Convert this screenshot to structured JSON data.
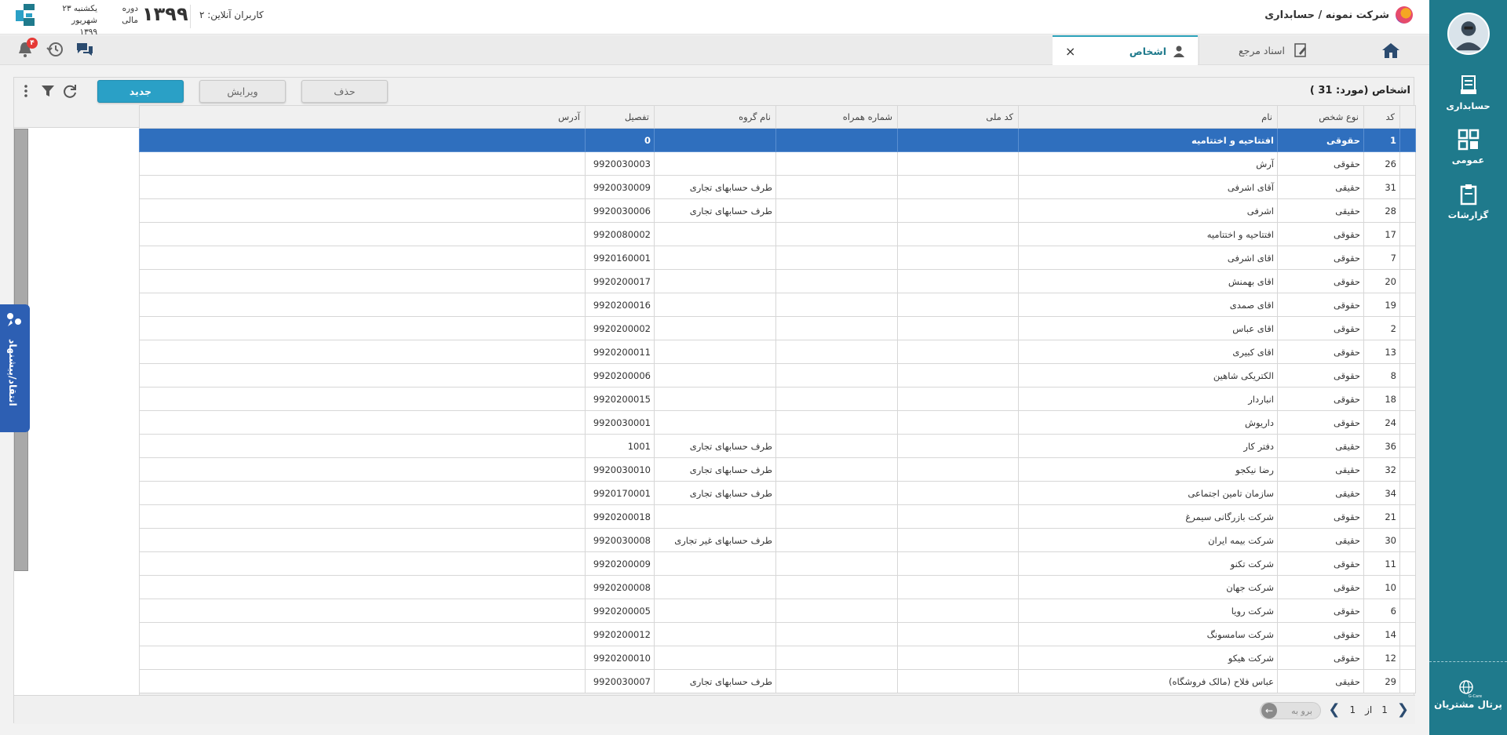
{
  "header": {
    "company": "شرکت نمونه / حسابداری",
    "online_users": "کاربران آنلاین: ۲",
    "fiscal_year": "۱۳۹۹",
    "period_line1": "دوره",
    "period_line2": "مالی",
    "date_line1": "یکشنبه ۲۳",
    "date_line2": "شهریور ۱۳۹۹",
    "notification_count": "۴"
  },
  "sidebar": {
    "items": [
      {
        "label": "حسابداری",
        "icon": "accounting-icon"
      },
      {
        "label": "عمومی",
        "icon": "general-icon"
      },
      {
        "label": "گزارشات",
        "icon": "reports-icon"
      }
    ],
    "portal_label": "پرتال مشتریان",
    "portal_sub": "G-Care"
  },
  "tabs": {
    "reference_docs": "اسناد مرجع",
    "persons": "اشخاص",
    "close_symbol": "×"
  },
  "panel": {
    "title": "اشخاص (مورد:  31 )",
    "btn_new": "جدید",
    "btn_edit": "ویرایش",
    "btn_delete": "حذف"
  },
  "table": {
    "columns": [
      "کد",
      "نوع شخص",
      "نام",
      "کد ملی",
      "شماره همراه",
      "نام گروه",
      "تفصیل",
      "آدرس"
    ],
    "rows": [
      [
        "1",
        "حقوقی",
        "افتتاحیه و اختتامیه",
        "",
        "",
        "",
        "0",
        ""
      ],
      [
        "26",
        "حقوقی",
        "آرش",
        "",
        "",
        "",
        "9920030003",
        ""
      ],
      [
        "31",
        "حقیقی",
        "آقای اشرفی",
        "",
        "",
        "طرف حسابهای تجاری",
        "9920030009",
        ""
      ],
      [
        "28",
        "حقیقی",
        "اشرفی",
        "",
        "",
        "طرف حسابهای تجاری",
        "9920030006",
        ""
      ],
      [
        "17",
        "حقوقی",
        "افتتاحیه و اختتامیه",
        "",
        "",
        "",
        "9920080002",
        ""
      ],
      [
        "7",
        "حقوقی",
        "اقای اشرفی",
        "",
        "",
        "",
        "9920160001",
        ""
      ],
      [
        "20",
        "حقوقی",
        "اقای بهمنش",
        "",
        "",
        "",
        "9920200017",
        ""
      ],
      [
        "19",
        "حقوقی",
        "اقای صمدی",
        "",
        "",
        "",
        "9920200016",
        ""
      ],
      [
        "2",
        "حقوقی",
        "اقای عباس",
        "",
        "",
        "",
        "9920200002",
        ""
      ],
      [
        "13",
        "حقوقی",
        "اقای کبیری",
        "",
        "",
        "",
        "9920200011",
        ""
      ],
      [
        "8",
        "حقوقی",
        "الکتریکی شاهین",
        "",
        "",
        "",
        "9920200006",
        ""
      ],
      [
        "18",
        "حقوقی",
        "انباردار",
        "",
        "",
        "",
        "9920200015",
        ""
      ],
      [
        "24",
        "حقوقی",
        "داریوش",
        "",
        "",
        "",
        "9920030001",
        ""
      ],
      [
        "36",
        "حقیقی",
        "دفتر کار",
        "",
        "",
        "طرف حسابهای تجاری",
        "1001",
        ""
      ],
      [
        "32",
        "حقیقی",
        "رضا نیکجو",
        "",
        "",
        "طرف حسابهای تجاری",
        "9920030010",
        ""
      ],
      [
        "34",
        "حقیقی",
        "سازمان تامین اجتماعی",
        "",
        "",
        "طرف حسابهای تجاری",
        "9920170001",
        ""
      ],
      [
        "21",
        "حقوقی",
        "شرکت بازرگانی سیمرغ",
        "",
        "",
        "",
        "9920200018",
        ""
      ],
      [
        "30",
        "حقیقی",
        "شرکت بیمه ایران",
        "",
        "",
        "طرف حسابهای غیر تجاری",
        "9920030008",
        ""
      ],
      [
        "11",
        "حقوقی",
        "شرکت تکنو",
        "",
        "",
        "",
        "9920200009",
        ""
      ],
      [
        "10",
        "حقوقی",
        "شرکت جهان",
        "",
        "",
        "",
        "9920200008",
        ""
      ],
      [
        "6",
        "حقوقی",
        "شرکت رویا",
        "",
        "",
        "",
        "9920200005",
        ""
      ],
      [
        "14",
        "حقوقی",
        "شرکت سامسونگ",
        "",
        "",
        "",
        "9920200012",
        ""
      ],
      [
        "12",
        "حقوقی",
        "شرکت هیکو",
        "",
        "",
        "",
        "9920200010",
        ""
      ],
      [
        "29",
        "حقیقی",
        "عباس فلاح (مالک فروشگاه)",
        "",
        "",
        "طرف حسابهای تجاری",
        "9920030007",
        ""
      ]
    ],
    "selected_row": 0
  },
  "pager": {
    "current": "1",
    "of": "از",
    "total": "1",
    "goto_label": "برو به"
  },
  "feedback": {
    "label": "انتقاد/پیشنهاد"
  },
  "colors": {
    "sidebar": "#1f7a8c",
    "primary_button": "#2aa0c6",
    "selected_row": "#2f6fbe",
    "badge": "#e53935"
  }
}
